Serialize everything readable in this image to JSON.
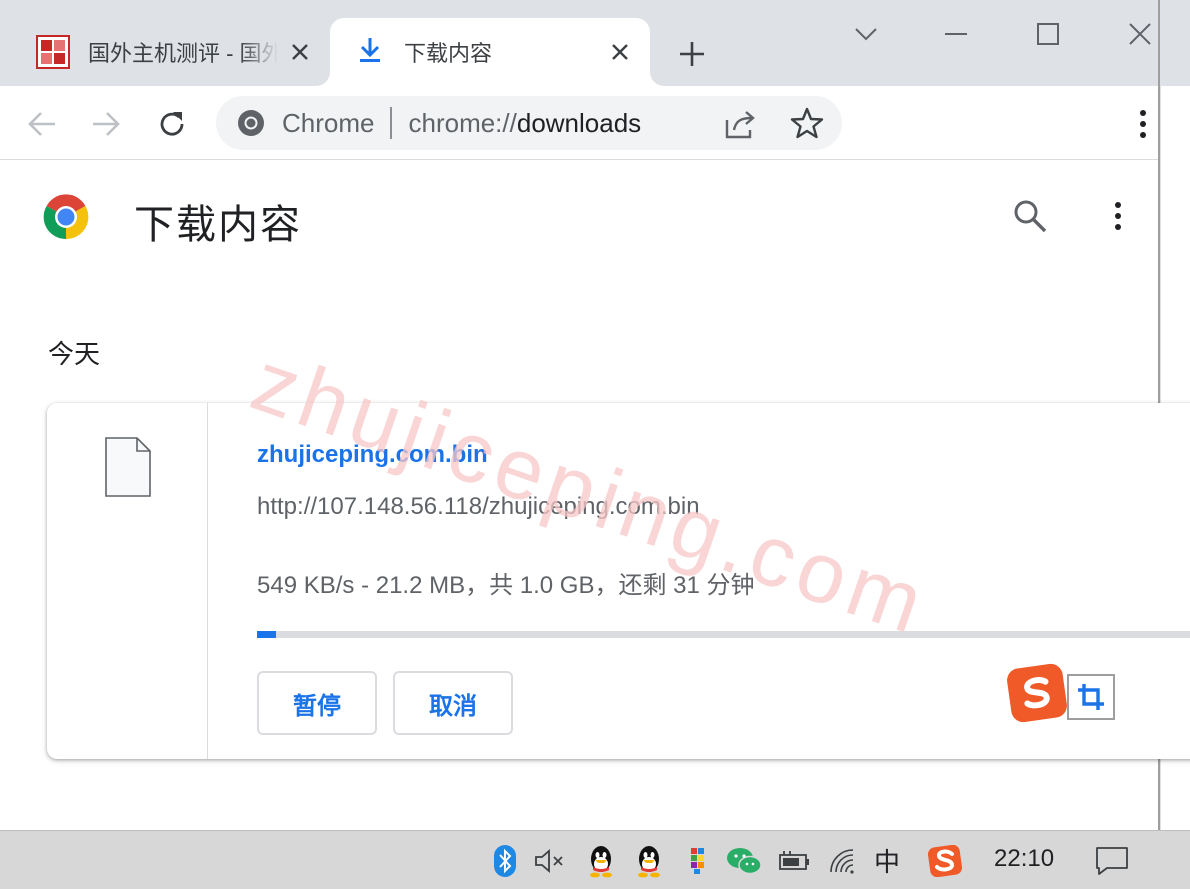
{
  "tabs": [
    {
      "title": "国外主机测评 - 国外主机测评",
      "active": false,
      "favicon": "site-logo-icon"
    },
    {
      "title": "下载内容",
      "active": true,
      "favicon": "download-arrow-icon"
    }
  ],
  "toolbar": {
    "omnibox": {
      "chip": "Chrome",
      "url_scheme": "chrome://",
      "url_path": "downloads"
    }
  },
  "page": {
    "title": "下载内容",
    "day_label": "今天"
  },
  "download": {
    "file_name": "zhujiceping.com.bin",
    "url": "http://107.148.56.118/zhujiceping.com.bin",
    "status": "549 KB/s - 21.2 MB，共 1.0 GB，还剩 31 分钟",
    "progress": 0.0207,
    "pause_label": "暂停",
    "cancel_label": "取消"
  },
  "watermark": "zhujiceping.com",
  "taskbar": {
    "ime_indicator": "中",
    "clock": "22:10",
    "tray_icons": [
      "bluetooth-icon",
      "volume-muted-icon",
      "qq-icon",
      "qq-icon",
      "app-color-icon",
      "wechat-icon",
      "battery-charging-icon",
      "wifi-icon",
      "ime-indicator",
      "sogou-ime-icon"
    ]
  },
  "colors": {
    "accent": "#1a73e8",
    "tabstrip": "#dee1e6",
    "sogou": "#f05a28",
    "watermark": "#f8c7c7"
  }
}
